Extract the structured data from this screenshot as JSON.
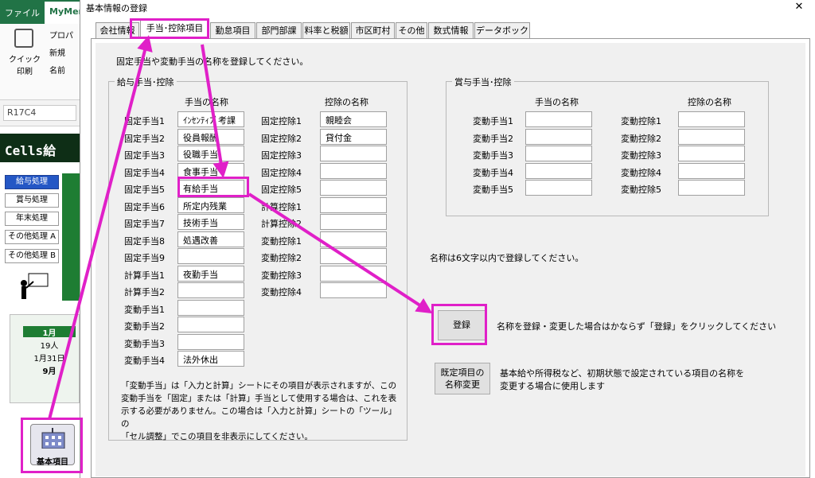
{
  "excel": {
    "tab_file": "ファイル",
    "tab_mymenu": "MyMen",
    "quick_print": "クイック\n印刷",
    "ribbon_items": [
      "プロパ",
      "新規",
      "名前"
    ],
    "namebox": "R17C4",
    "banner": "Cells給",
    "side_buttons": [
      "給与処理",
      "賞与処理",
      "年末処理",
      "その他処理 A",
      "その他処理 B"
    ],
    "calendar": {
      "header": "1月",
      "rows": [
        "19人",
        "1月31日",
        "9月"
      ]
    },
    "base_button": "基本項目"
  },
  "dialog": {
    "title": "基本情報の登録",
    "close": "✕",
    "tabs": [
      "会社情報",
      "手当･控除項目",
      "勤怠項目",
      "部門部課",
      "料率と税額",
      "市区町村",
      "その他",
      "数式情報",
      "データボックス"
    ],
    "active_tab": 1,
    "instruction": "固定手当や変動手当の名称を登録してください。",
    "kyuyo": {
      "legend": "給与手当･控除",
      "col_allowance": "手当の名称",
      "col_deduction": "控除の名称",
      "allowance_labels": [
        "固定手当1",
        "固定手当2",
        "固定手当3",
        "固定手当4",
        "固定手当5",
        "固定手当6",
        "固定手当7",
        "固定手当8",
        "固定手当9",
        "計算手当1",
        "計算手当2",
        "変動手当1",
        "変動手当2",
        "変動手当3",
        "変動手当4"
      ],
      "allowance_values": [
        "ｲﾝｾﾝﾃｨﾌﾞ考課",
        "役員報酬",
        "役職手当",
        "食事手当",
        "有給手当",
        "所定内残業",
        "技術手当",
        "処遇改善",
        "",
        "夜勤手当",
        "",
        "",
        "",
        "",
        "法外休出"
      ],
      "deduction_labels": [
        "固定控除1",
        "固定控除2",
        "固定控除3",
        "固定控除4",
        "固定控除5",
        "計算控除1",
        "計算控除2",
        "変動控除1",
        "変動控除2",
        "変動控除3",
        "変動控除4"
      ],
      "deduction_values": [
        "親睦会",
        "貸付金",
        "",
        "",
        "",
        "",
        "",
        "",
        "",
        "",
        ""
      ]
    },
    "shoyo": {
      "legend": "賞与手当･控除",
      "col_allowance": "手当の名称",
      "col_deduction": "控除の名称",
      "allowance_labels": [
        "変動手当1",
        "変動手当2",
        "変動手当3",
        "変動手当4",
        "変動手当5"
      ],
      "deduction_labels": [
        "変動控除1",
        "変動控除2",
        "変動控除3",
        "変動控除4",
        "変動控除5"
      ]
    },
    "note_len": "名称は6文字以内で登録してください。",
    "register_button": "登録",
    "register_note": "名称を登録・変更した場合はかならず「登録」をクリックしてください",
    "default_button": "既定項目の\n名称変更",
    "default_note": "基本給や所得税など、初期状態で設定されている項目の名称を\n変更する場合に使用します",
    "bottom_note": "「変動手当」は「入力と計算」シートにその項目が表示されますが、この\n変動手当を「固定」または「計算」手当として使用する場合は、これを表\n示する必要がありません。この場合は「入力と計算」シートの「ツール」の\n「セル調整」でこの項目を非表示にしてください。"
  },
  "colors": {
    "annotation": "#e020c8",
    "excel_green": "#217346"
  }
}
